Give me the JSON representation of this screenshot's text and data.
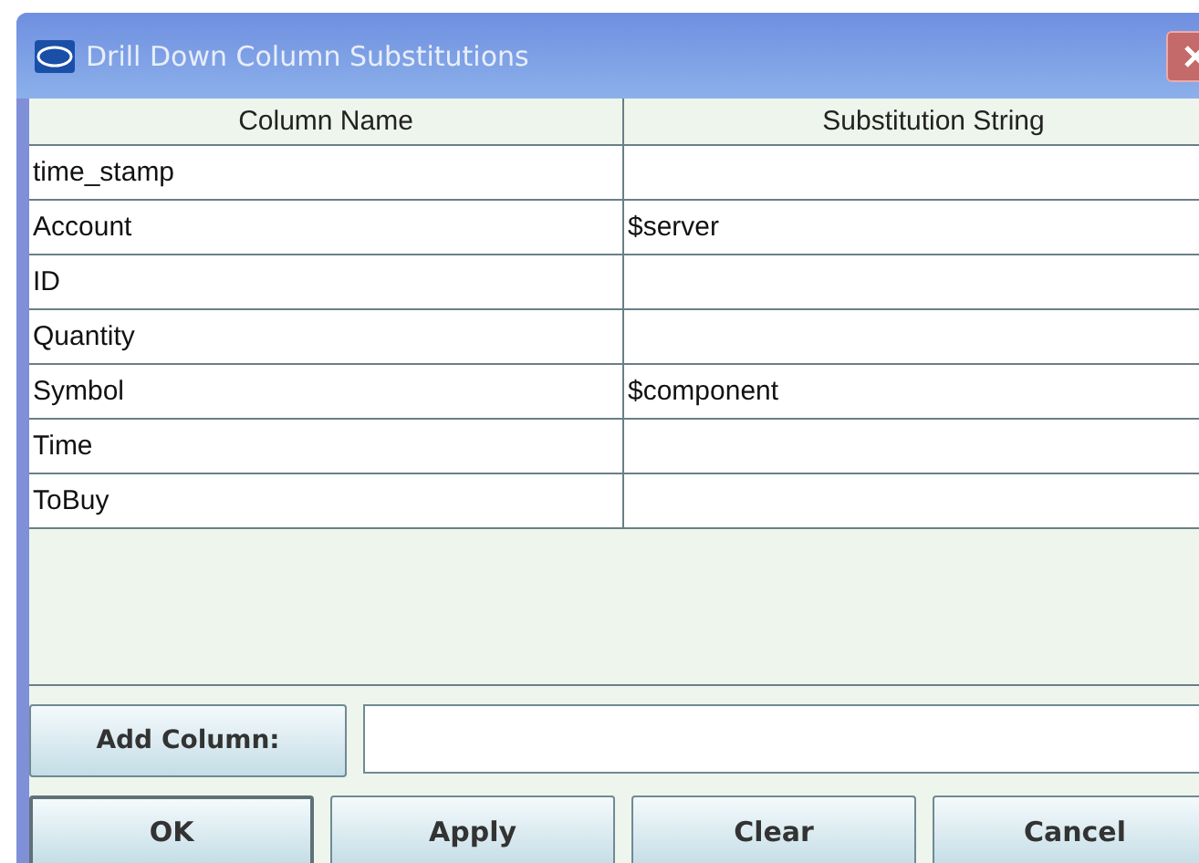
{
  "window": {
    "title": "Drill Down Column Substitutions"
  },
  "table": {
    "columns": [
      "Column Name",
      "Substitution String"
    ],
    "rows": [
      [
        "time_stamp",
        ""
      ],
      [
        "Account",
        "$server"
      ],
      [
        "ID",
        ""
      ],
      [
        "Quantity",
        ""
      ],
      [
        "Symbol",
        "$component"
      ],
      [
        "Time",
        ""
      ],
      [
        "ToBuy",
        ""
      ]
    ]
  },
  "add_column": {
    "button": "Add Column:"
  },
  "buttons": [
    {
      "label": "OK",
      "focused": true
    },
    {
      "label": "Apply",
      "focused": false
    },
    {
      "label": "Clear",
      "focused": false
    },
    {
      "label": "Cancel",
      "focused": false
    }
  ]
}
